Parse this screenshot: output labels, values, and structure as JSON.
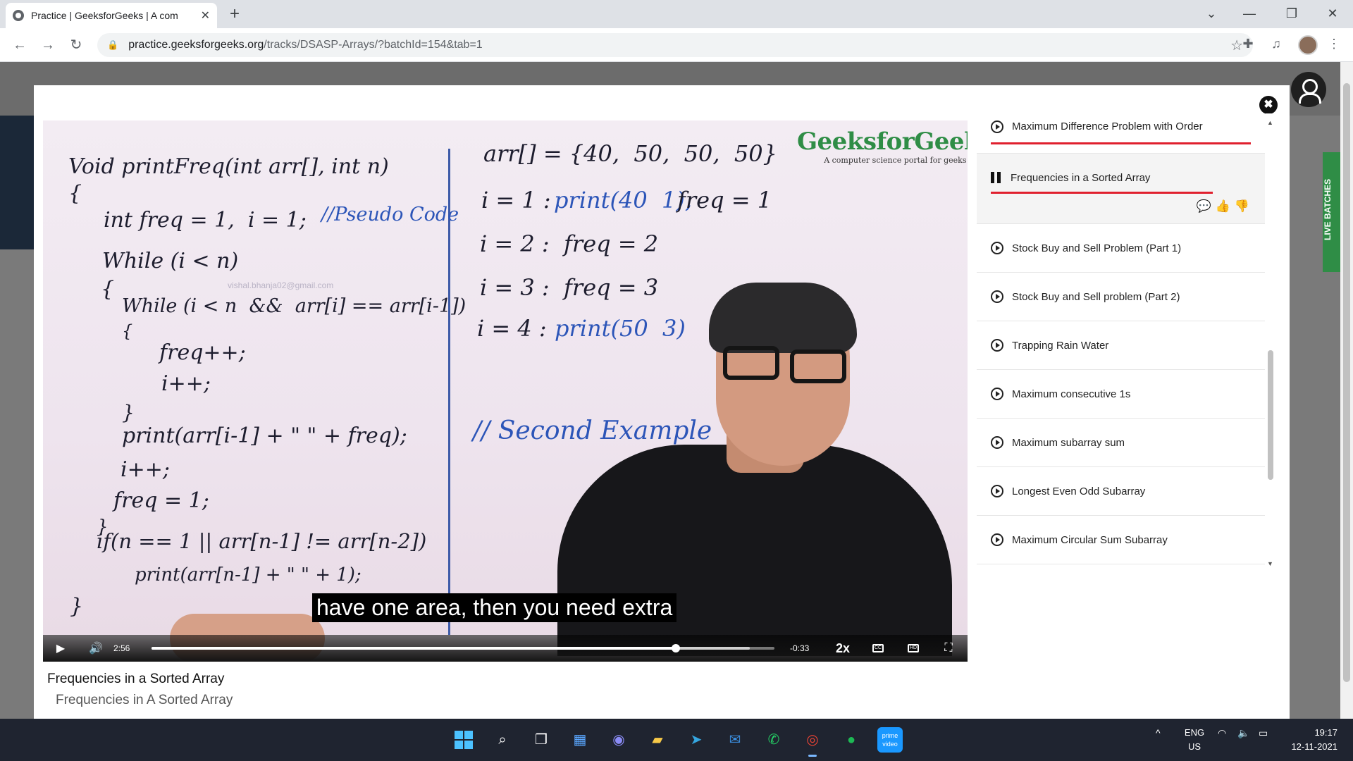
{
  "browser": {
    "tab_title": "Practice | GeeksforGeeks | A com",
    "tab_close": "✕",
    "new_tab": "+",
    "url_domain": "practice.geeksforgeeks.org",
    "url_path": "/tracks/DSASP-Arrays/?batchId=154&tab=1",
    "back": "←",
    "forward": "→",
    "reload": "↻",
    "star": "☆",
    "window_controls": {
      "chevron": "⌄",
      "minimize": "—",
      "restore": "❐",
      "close": "✕"
    }
  },
  "page": {
    "live_batches_label": "LIVE BATCHES"
  },
  "modal": {
    "close_label": "✖"
  },
  "video": {
    "logo_name": "GeeksforGeeks",
    "logo_tagline": "A computer science portal for geeks",
    "watermark": "vishal.bhanja02@gmail.com",
    "subtitle": "have one area, then you need extra",
    "board_left": [
      "Void printFreq(int arr[], int n)",
      "{",
      "int freq = 1,  i = 1;",
      "//Pseudo Code",
      "While (i < n)",
      "{",
      "While (i < n  &&  arr[i] == arr[i-1])",
      "{",
      "freq++;",
      "i++;",
      "}",
      "print(arr[i-1] + \" \" + freq);",
      "i++;",
      "freq = 1;",
      "}",
      "if(n == 1 || arr[n-1] != arr[n-2])",
      "print(arr[n-1] + \" \" + 1);",
      "}"
    ],
    "board_right": [
      "arr[] = {40,  50,  50,  50}",
      "i = 1 :",
      "print(40  1),",
      "freq = 1",
      "i = 2 :  freq = 2",
      "i = 3 :  freq = 3",
      "i = 4 :",
      "print(50  3)",
      "// Second Example"
    ],
    "controls": {
      "play": "▶",
      "volume": "🔊",
      "elapsed": "2:56",
      "remaining": "-0:33",
      "speed": "2x",
      "cc": "CC",
      "hd": "HD",
      "fullscreen": "⛶",
      "progress_played_fraction": 0.842,
      "progress_buffered_fraction": 0.96
    },
    "title": "Frequencies in a Sorted Array",
    "subtitle_below": "Frequencies in A Sorted Array"
  },
  "playlist": {
    "items": [
      {
        "label": "Maximum Difference Problem with Order",
        "state": "watched"
      },
      {
        "label": "Frequencies in a Sorted Array",
        "state": "playing"
      },
      {
        "label": "Stock Buy and Sell Problem (Part 1)",
        "state": "normal"
      },
      {
        "label": "Stock Buy and Sell problem (Part 2)",
        "state": "normal"
      },
      {
        "label": "Trapping Rain Water",
        "state": "normal"
      },
      {
        "label": "Maximum consecutive 1s",
        "state": "normal"
      },
      {
        "label": "Maximum subarray sum",
        "state": "normal"
      },
      {
        "label": "Longest Even Odd Subarray",
        "state": "normal"
      },
      {
        "label": "Maximum Circular Sum Subarray",
        "state": "normal"
      }
    ],
    "feedback": {
      "comment": "💬",
      "like": "👍",
      "dislike": "👎"
    }
  },
  "taskbar": {
    "apps": [
      "start",
      "search",
      "task-view",
      "widgets",
      "teams-chat",
      "file-explorer",
      "telegram",
      "mail",
      "whatsapp",
      "chrome",
      "spotify",
      "prime-video"
    ],
    "lang_top": "ENG",
    "lang_bottom": "US",
    "time": "19:17",
    "date": "12-11-2021",
    "tray_chevron": "^"
  }
}
